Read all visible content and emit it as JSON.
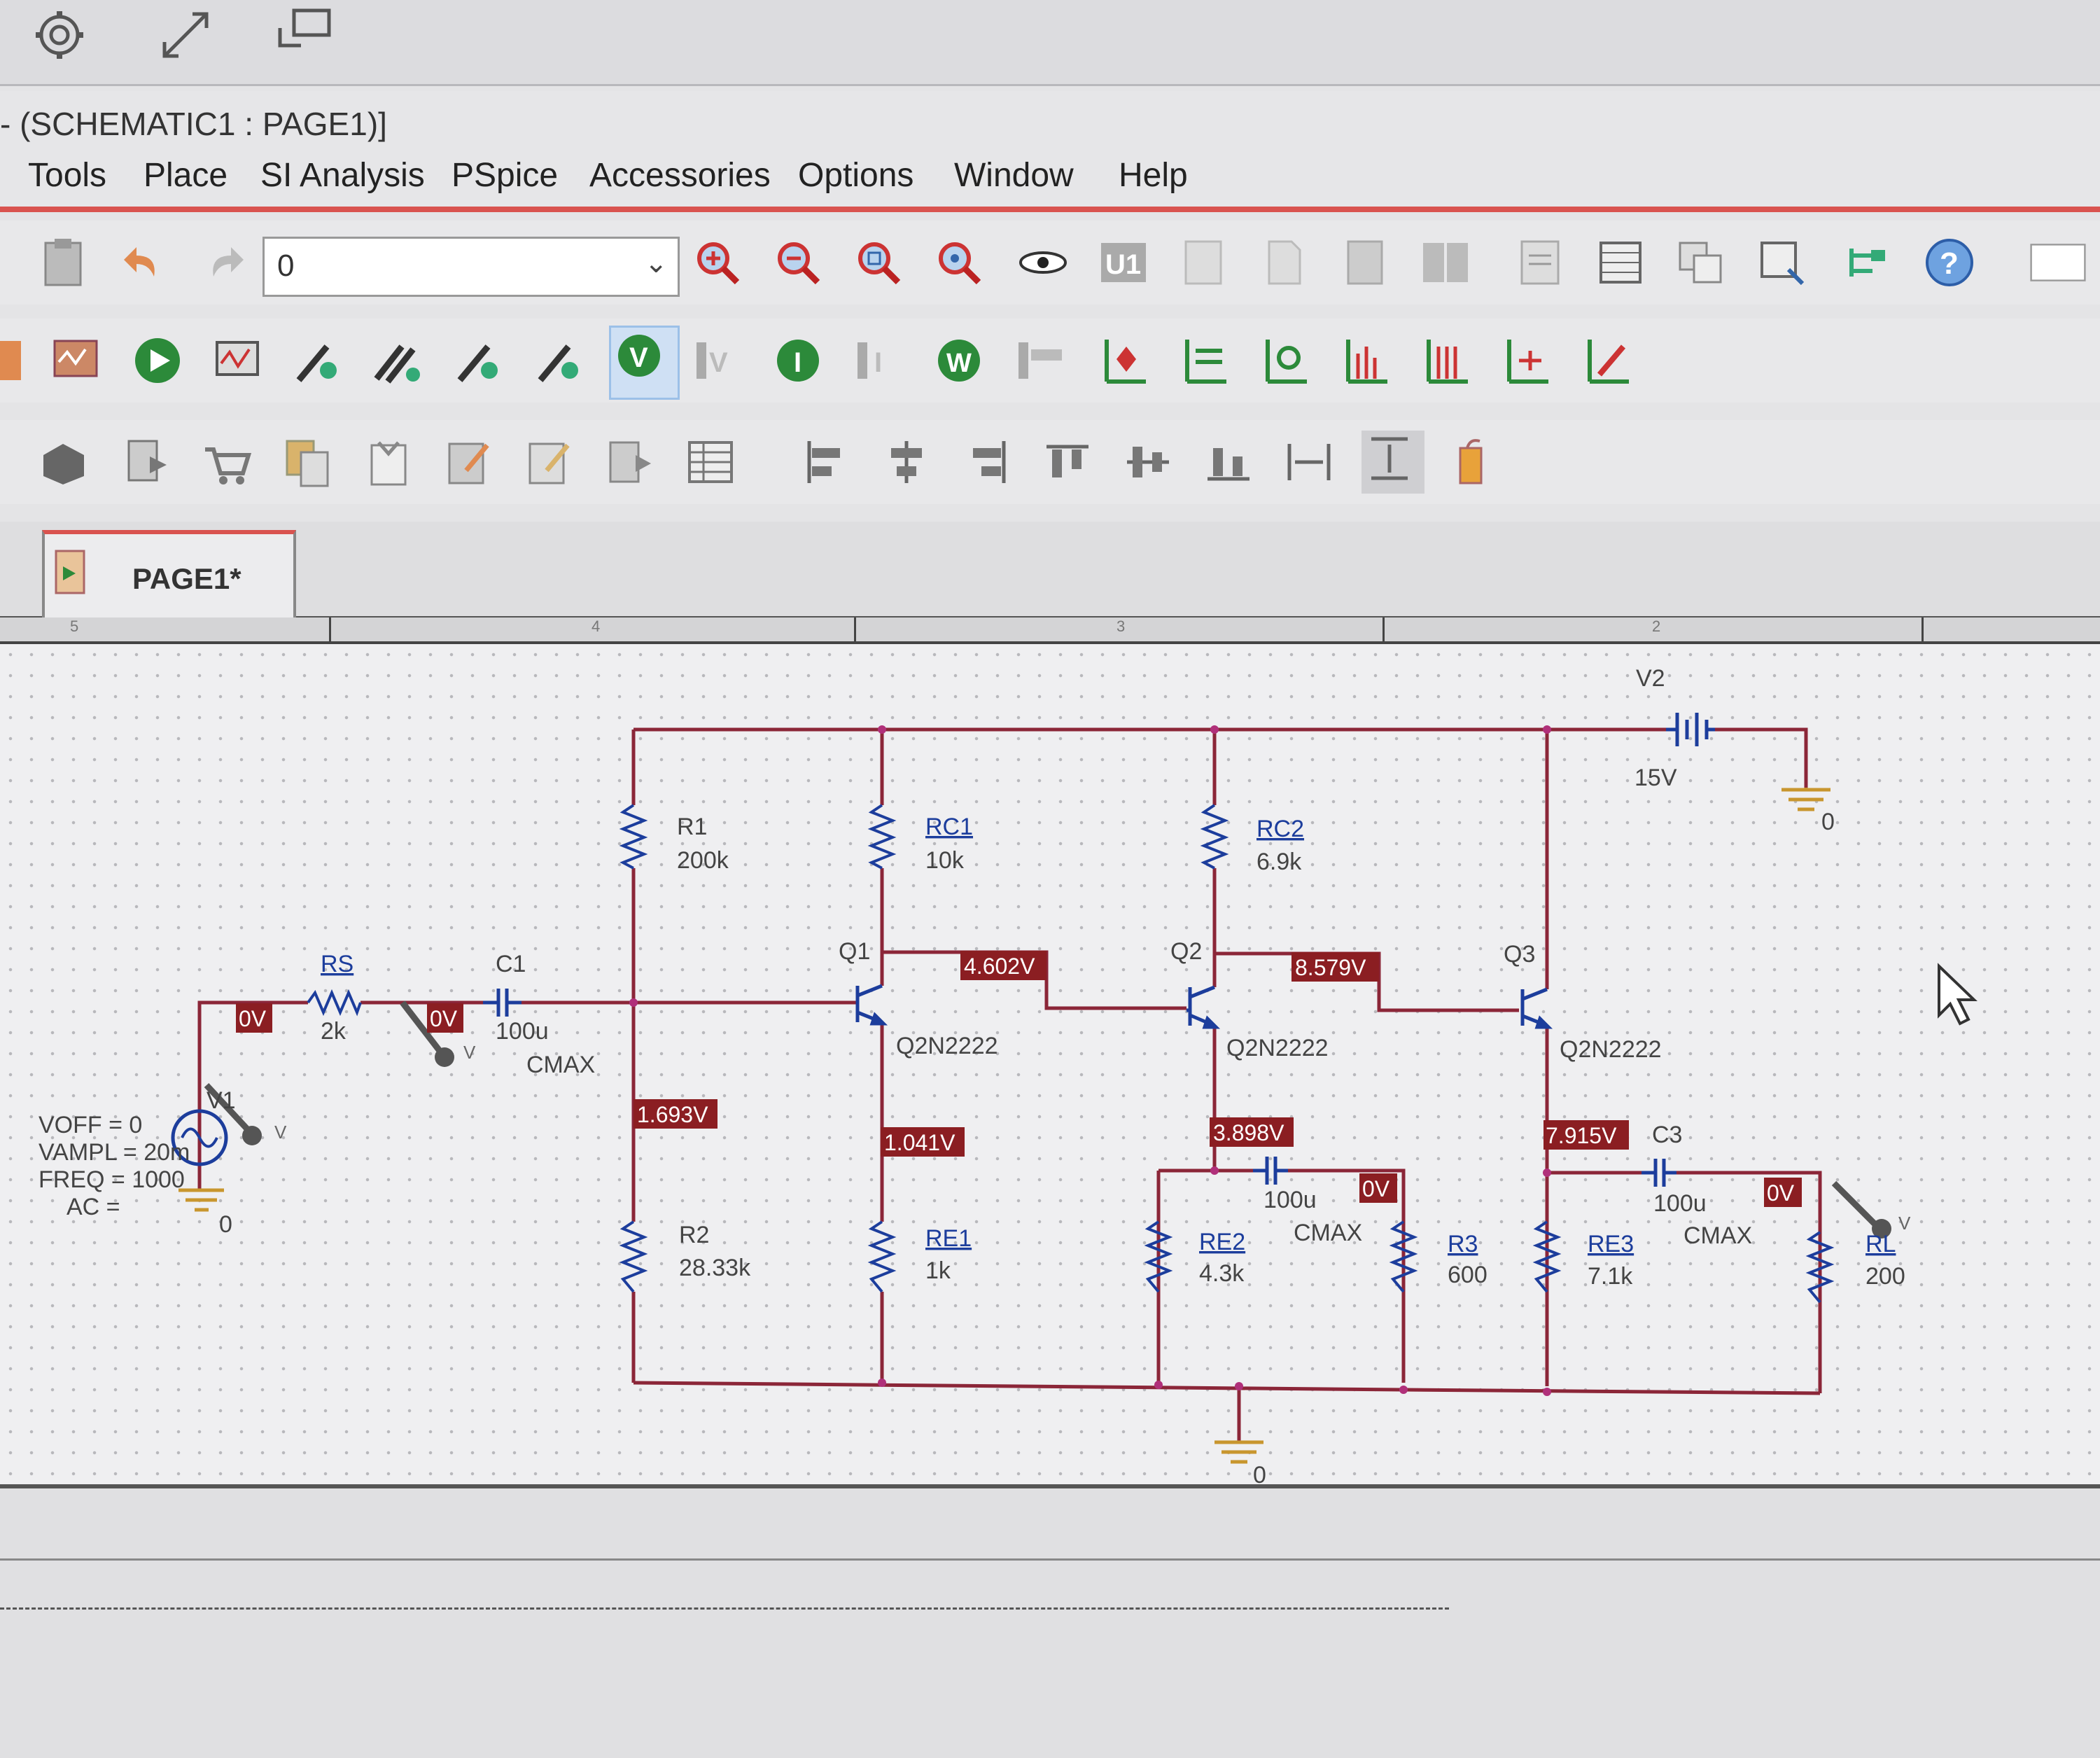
{
  "window": {
    "title": "- (SCHEMATIC1 : PAGE1)]"
  },
  "menu": [
    "Tools",
    "Place",
    "SI Analysis",
    "PSpice",
    "Accessories",
    "Options",
    "Window",
    "Help"
  ],
  "toolbar": {
    "part_combo_value": "0"
  },
  "tab": {
    "label": "PAGE1*"
  },
  "ruler": [
    "5",
    "4",
    "3",
    "2"
  ],
  "schematic": {
    "components": {
      "V2": {
        "name": "V2",
        "value": "15V"
      },
      "R1": {
        "name": "R1",
        "value": "200k"
      },
      "RC1": {
        "name": "RC1",
        "value": "10k"
      },
      "RC2": {
        "name": "RC2",
        "value": "6.9k"
      },
      "Q1": {
        "name": "Q1",
        "model": "Q2N2222"
      },
      "Q2": {
        "name": "Q2",
        "model": "Q2N2222"
      },
      "Q3": {
        "name": "Q3",
        "model": "Q2N2222"
      },
      "RS": {
        "name": "RS",
        "value": "2k"
      },
      "C1": {
        "name": "C1",
        "value": "100u",
        "tol": "CMAX"
      },
      "V1": {
        "name": "V1",
        "params": [
          "VOFF = 0",
          "VAMPL = 20m",
          "FREQ = 1000",
          "AC ="
        ]
      },
      "R2": {
        "name": "R2",
        "value": "28.33k"
      },
      "RE1": {
        "name": "RE1",
        "value": "1k"
      },
      "RE2": {
        "name": "RE2",
        "value": "4.3k"
      },
      "C2": {
        "value": "100u",
        "tol": "CMAX"
      },
      "R3": {
        "name": "R3",
        "value": "600"
      },
      "RE3": {
        "name": "RE3",
        "value": "7.1k"
      },
      "C3": {
        "name": "C3",
        "value": "100u",
        "tol": "CMAX"
      },
      "RL": {
        "name": "RL",
        "value": "200"
      }
    },
    "voltage_markers": {
      "vs_node": "0V",
      "rs_c1_node": "0V",
      "q1_collector": "4.602V",
      "q2_collector": "8.579V",
      "q1_base": "1.693V",
      "q1_emitter": "1.041V",
      "q2_emitter": "3.898V",
      "q3_emitter": "7.915V",
      "r3_node": "0V",
      "rl_node": "0V"
    },
    "ground_labels": [
      "0",
      "0",
      "0"
    ],
    "probe_label": "V"
  }
}
